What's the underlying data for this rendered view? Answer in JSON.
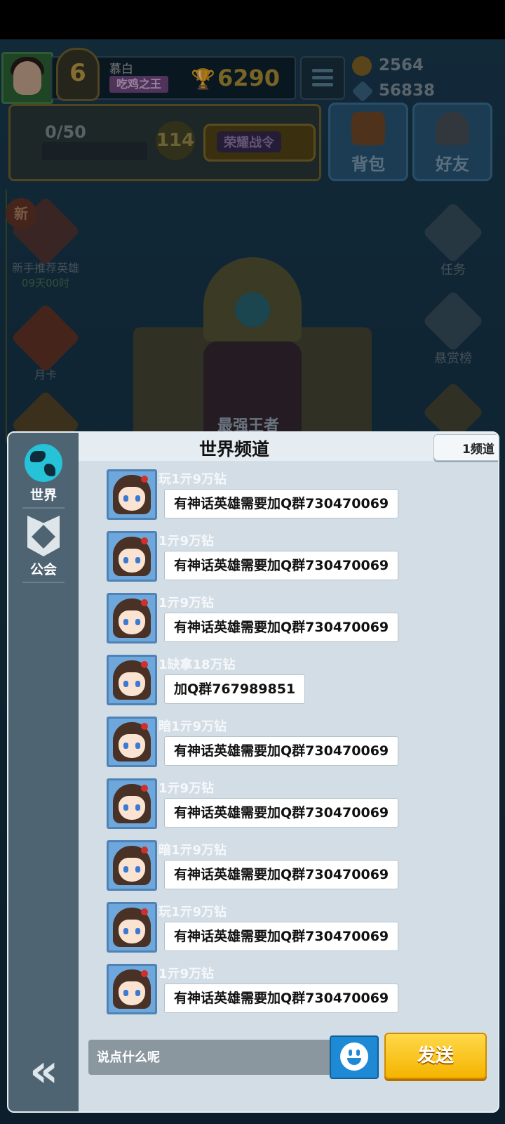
{
  "game_hud": {
    "player_name": "慕白",
    "player_title": "吃鸡之王",
    "level": "6",
    "trophies": "6290",
    "gold": "2564",
    "gems": "56838",
    "pass_progress": "0/50",
    "pass_level": "114",
    "pass_button": "荣耀战令",
    "bag_label": "背包",
    "friends_label": "好友",
    "new_badge": "新",
    "hero_recommend_label": "新手推荐英雄",
    "hero_recommend_timer": "09天00时",
    "month_card_label": "月卡",
    "quest_label": "任务",
    "bounty_label": "悬赏榜",
    "throne_label": "最强王者"
  },
  "chat": {
    "title": "世界频道",
    "channel": "1频道",
    "tabs": [
      {
        "label": "世界"
      },
      {
        "label": "公会"
      }
    ],
    "messages": [
      {
        "user": "玩1亓9万钻",
        "text": "有神话英雄需要加Q群730470069"
      },
      {
        "user": "1亓9万钻",
        "text": "有神话英雄需要加Q群730470069"
      },
      {
        "user": "1亓9万钻",
        "text": "有神话英雄需要加Q群730470069"
      },
      {
        "user": "1缺拿18万钻",
        "text": "加Q群767989851"
      },
      {
        "user": "暗1亓9万钻",
        "text": "有神话英雄需要加Q群730470069"
      },
      {
        "user": "1亓9万钻",
        "text": "有神话英雄需要加Q群730470069"
      },
      {
        "user": "暗1亓9万钻",
        "text": "有神话英雄需要加Q群730470069"
      },
      {
        "user": "玩1亓9万钻",
        "text": "有神话英雄需要加Q群730470069"
      },
      {
        "user": "1亓9万钻",
        "text": "有神话英雄需要加Q群730470069"
      }
    ],
    "input_placeholder": "说点什么呢",
    "send_label": "发送",
    "back_glyph": "«"
  }
}
